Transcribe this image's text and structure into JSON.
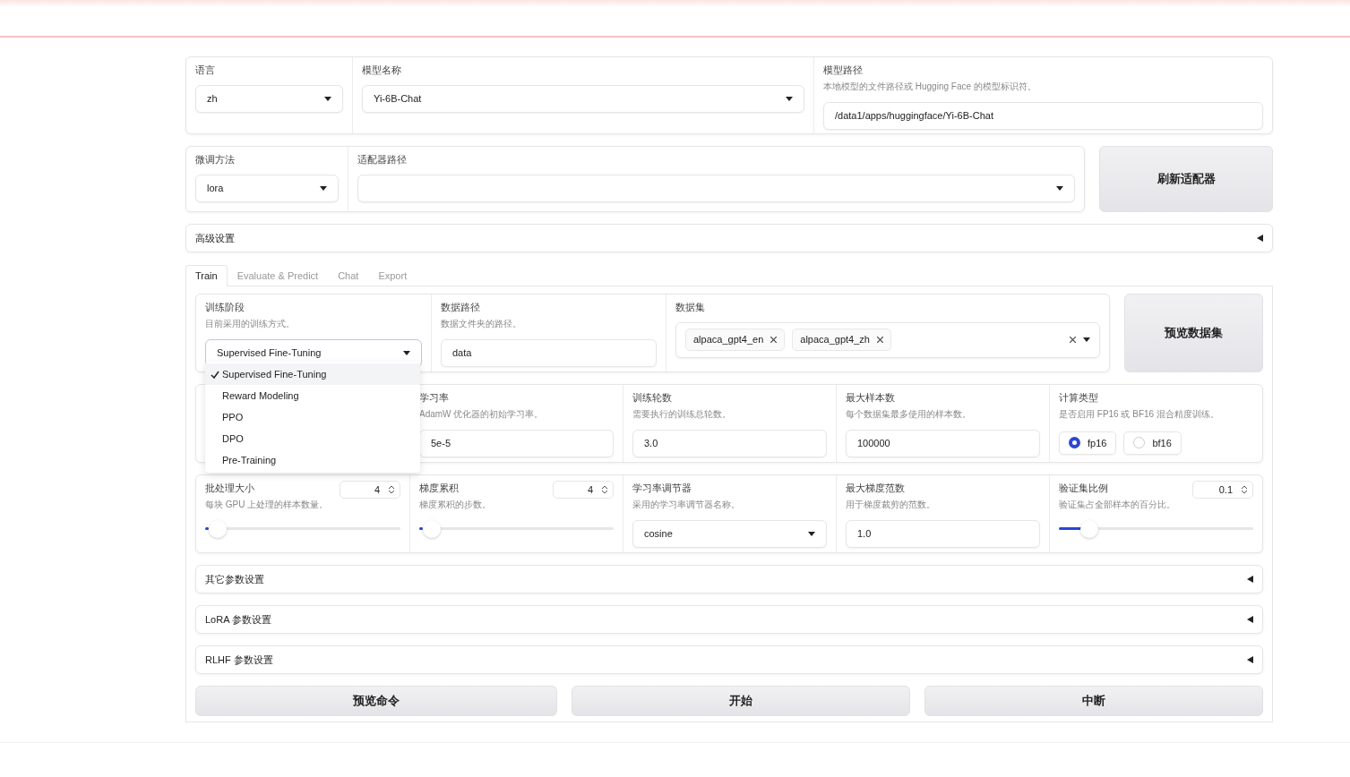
{
  "top_row": {
    "fields": [
      {
        "kind": "select",
        "label": "语言",
        "value": "zh"
      },
      {
        "kind": "select",
        "label": "模型名称",
        "value": "Yi-6B-Chat"
      },
      {
        "kind": "text",
        "label": "模型路径",
        "info": "本地模型的文件路径或 Hugging Face 的模型标识符。",
        "value": "/data1/apps/huggingface/Yi-6B-Chat"
      }
    ]
  },
  "adapter_row": {
    "fields": [
      {
        "kind": "select",
        "label": "微调方法",
        "value": "lora"
      },
      {
        "kind": "select",
        "label": "适配器路径"
      }
    ],
    "button": "刷新适配器"
  },
  "advanced": {
    "label": "高级设置",
    "expanded": false
  },
  "tabs": [
    {
      "label": "Train",
      "selected": true
    },
    {
      "label": "Evaluate & Predict",
      "selected": false
    },
    {
      "label": "Chat",
      "selected": false
    },
    {
      "label": "Export",
      "selected": false
    }
  ],
  "train": {
    "stage_row": {
      "fields": [
        {
          "kind": "select",
          "label": "训练阶段",
          "info": "目前采用的训练方式。",
          "value": "Supervised Fine-Tuning",
          "open": true,
          "options": [
            {
              "label": "Supervised Fine-Tuning",
              "selected": true
            },
            {
              "label": "Reward Modeling",
              "selected": false
            },
            {
              "label": "PPO",
              "selected": false
            },
            {
              "label": "DPO",
              "selected": false
            },
            {
              "label": "Pre-Training",
              "selected": false
            }
          ]
        },
        {
          "kind": "text",
          "label": "数据路径",
          "info": "数据文件夹的路径。",
          "value": "data"
        },
        {
          "kind": "multiselect",
          "label": "数据集",
          "tags": [
            "alpaca_gpt4_en",
            "alpaca_gpt4_zh"
          ]
        }
      ],
      "button": "预览数据集"
    },
    "param_rows": [
      [
        {
          "kind": "blank"
        },
        {
          "kind": "text",
          "label": "学习率",
          "info": "AdamW 优化器的初始学习率。",
          "value": "5e-5"
        },
        {
          "kind": "text",
          "label": "训练轮数",
          "info": "需要执行的训练总轮数。",
          "value": "3.0"
        },
        {
          "kind": "text",
          "label": "最大样本数",
          "info": "每个数据集最多使用的样本数。",
          "value": "100000"
        },
        {
          "kind": "radio",
          "label": "计算类型",
          "info": "是否启用 FP16 或 BF16 混合精度训练。",
          "options": [
            {
              "label": "fp16",
              "selected": true
            },
            {
              "label": "bf16",
              "selected": false
            }
          ]
        }
      ],
      [
        {
          "kind": "slider",
          "label": "批处理大小",
          "info": "每块 GPU 上处理的样本数量。",
          "value": "4",
          "level": 0.02
        },
        {
          "kind": "slider",
          "label": "梯度累积",
          "info": "梯度累积的步数。",
          "value": "4",
          "level": 0.02
        },
        {
          "kind": "select",
          "label": "学习率调节器",
          "info": "采用的学习率调节器名称。",
          "value": "cosine"
        },
        {
          "kind": "text",
          "label": "最大梯度范数",
          "info": "用于梯度裁剪的范数。",
          "value": "1.0"
        },
        {
          "kind": "slider",
          "label": "验证集比例",
          "info": "验证集占全部样本的百分比。",
          "value": "0.1",
          "level": 0.12
        }
      ]
    ],
    "sections": [
      {
        "label": "其它参数设置",
        "expanded": false
      },
      {
        "label": "LoRA 参数设置",
        "expanded": false
      },
      {
        "label": "RLHF 参数设置",
        "expanded": false
      }
    ],
    "buttons": [
      "预览命令",
      "开始",
      "中断"
    ]
  }
}
